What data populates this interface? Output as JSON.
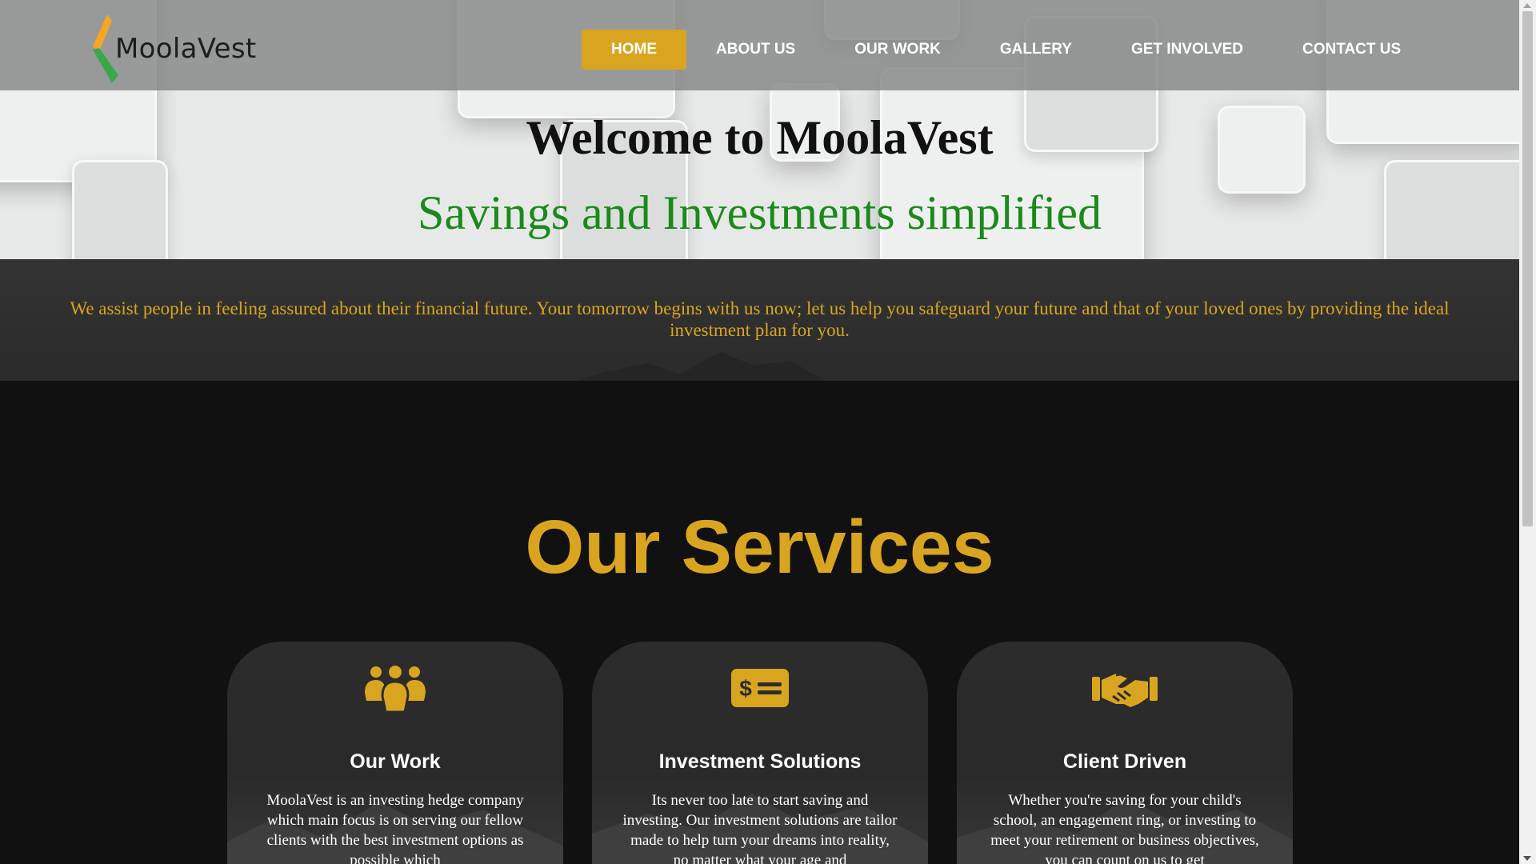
{
  "brand": {
    "name": "MoolaVest",
    "colors": {
      "gold": "#d9a520",
      "green": "#1a8a1a",
      "orange": "#f5a623"
    }
  },
  "nav": {
    "items": [
      {
        "label": "HOME",
        "active": true
      },
      {
        "label": "ABOUT US"
      },
      {
        "label": "OUR WORK"
      },
      {
        "label": "GALLERY"
      },
      {
        "label": "GET INVOLVED"
      },
      {
        "label": "CONTACT US"
      }
    ]
  },
  "hero": {
    "title": "Welcome to MoolaVest",
    "subtitle": "Savings and Investments simplified"
  },
  "intro": {
    "text": "We assist people in feeling assured about their financial future. Your tomorrow begins with us now; let us help you safeguard your future and that of your loved ones by providing the ideal investment plan for you."
  },
  "services": {
    "title": "Our Services",
    "cards": [
      {
        "icon": "people-group-icon",
        "title": "Our Work",
        "text": "MoolaVest is an investing hedge company which main focus is on serving our fellow clients with the best investment options as possible which"
      },
      {
        "icon": "money-check-icon",
        "title": "Investment Solutions",
        "text": "Its never too late to start saving and investing. Our investment solutions are tailor made to help turn your dreams into reality, no matter what your age and"
      },
      {
        "icon": "handshake-icon",
        "title": "Client Driven",
        "text": "Whether you're saving for your child's school, an engagement ring, or investing to meet your retirement or business objectives, you can count on us to get"
      }
    ]
  }
}
